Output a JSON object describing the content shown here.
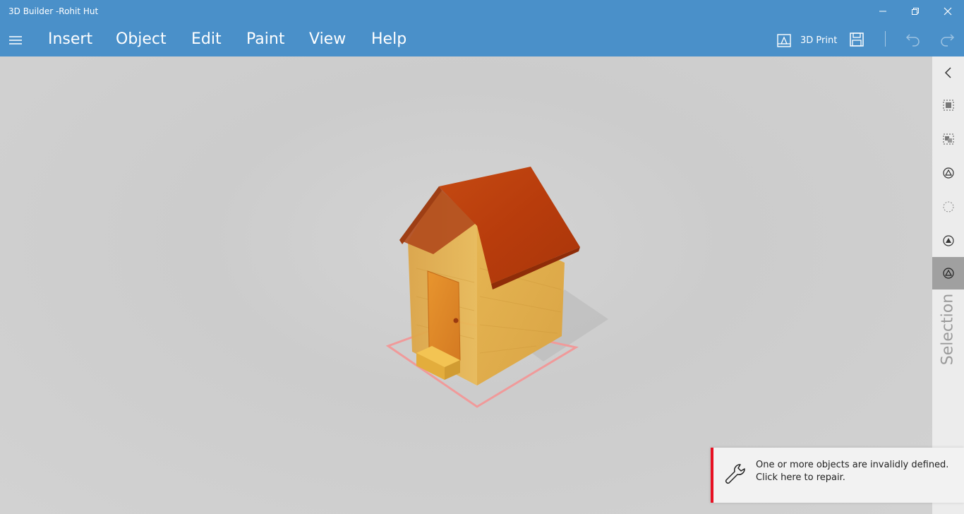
{
  "window": {
    "title": "3D Builder -Rohit Hut"
  },
  "menu": {
    "items": [
      "Insert",
      "Object",
      "Edit",
      "Paint",
      "View",
      "Help"
    ],
    "print_label": "3D Print"
  },
  "side_panel": {
    "label": "Selection"
  },
  "toast": {
    "line1": "One or more objects are invalidly defined.",
    "line2": "Click here to repair."
  },
  "colors": {
    "accent": "#4a90c9",
    "toast_border": "#e81123",
    "roof": "#c0420e",
    "wall": "#e6b550",
    "door": "#e08a2a"
  }
}
